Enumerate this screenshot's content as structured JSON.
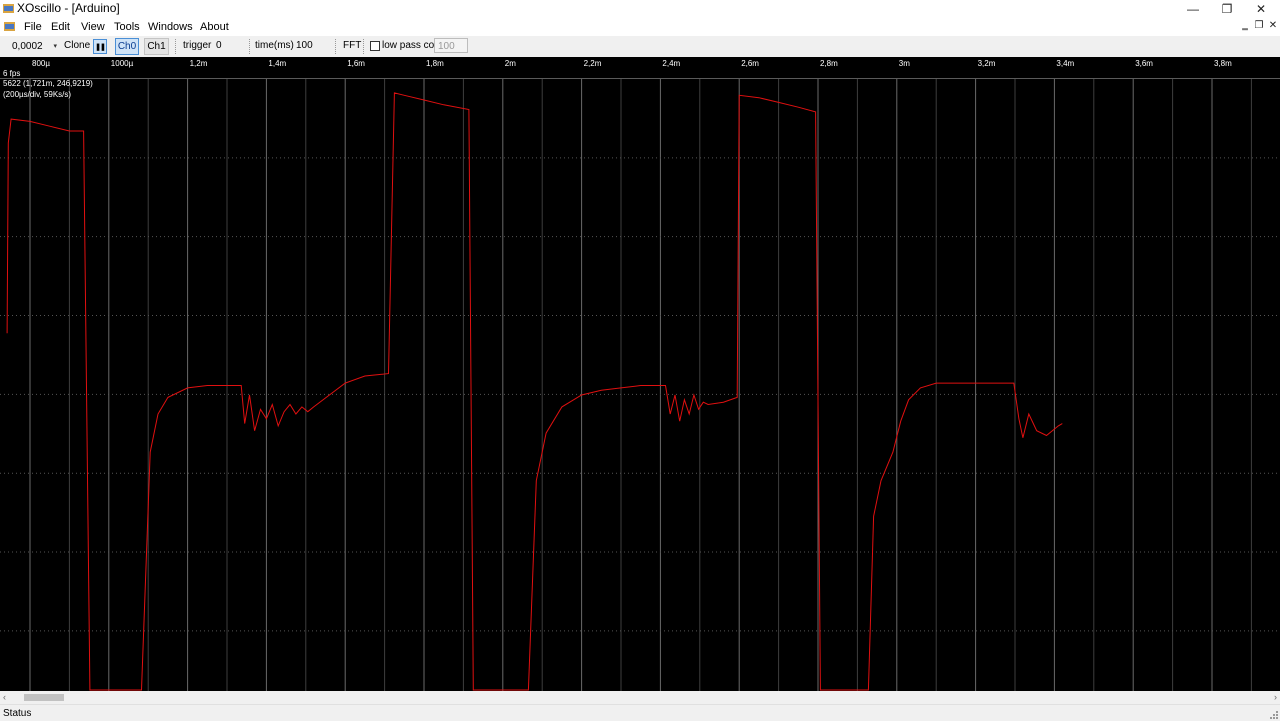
{
  "window": {
    "title": "XOscillo - [Arduino]",
    "minimize_glyph": "—",
    "maximize_glyph": "❐",
    "close_glyph": "✕"
  },
  "menu": {
    "items": [
      "File",
      "Edit",
      "View",
      "Tools",
      "Windows",
      "About"
    ],
    "mdi_minimize": "‗",
    "mdi_restore": "❐",
    "mdi_close": "✕"
  },
  "toolbar": {
    "scale_value": "0,0002",
    "combo_arrow": "▾",
    "clone_label": "Clone",
    "pause_glyph": "❚❚",
    "ch0_label": "Ch0",
    "ch1_label": "Ch1",
    "trigger_label": "trigger",
    "trigger_value": "0",
    "time_label": "time(ms)",
    "time_value": "100",
    "fft_label": "FFT",
    "lowpass_label": "low pass cof",
    "lowpass_value": "100"
  },
  "scope": {
    "fps": "6 fps",
    "cursor": "5622 (1,721m, 246,9219)",
    "scale_info": "(200µs/div, 59Ks/s)",
    "x_ticks": [
      "800µ",
      "1000µ",
      "1,2m",
      "1,4m",
      "1,6m",
      "1,8m",
      "2m",
      "2,2m",
      "2,4m",
      "2,6m",
      "2,8m",
      "3m",
      "3,2m",
      "3,4m",
      "3,6m",
      "3,8m"
    ],
    "trace_color": "#e01010",
    "grid_color": "#5a5a5a",
    "signal": {
      "time_axis": [
        0.74,
        3.96
      ],
      "value_axis": [
        0,
        256
      ],
      "points": [
        [
          0.742,
          150
        ],
        [
          0.745,
          230
        ],
        [
          0.752,
          240
        ],
        [
          0.8,
          239
        ],
        [
          0.85,
          237
        ],
        [
          0.9,
          235
        ],
        [
          0.936,
          235
        ],
        [
          0.952,
          0
        ],
        [
          1.01,
          0
        ],
        [
          1.083,
          0
        ],
        [
          1.105,
          100
        ],
        [
          1.125,
          116
        ],
        [
          1.15,
          123
        ],
        [
          1.2,
          127
        ],
        [
          1.25,
          128
        ],
        [
          1.3,
          128
        ],
        [
          1.336,
          128
        ],
        [
          1.345,
          112
        ],
        [
          1.357,
          124
        ],
        [
          1.37,
          109
        ],
        [
          1.385,
          118
        ],
        [
          1.4,
          114
        ],
        [
          1.415,
          120
        ],
        [
          1.43,
          111
        ],
        [
          1.445,
          117
        ],
        [
          1.46,
          120
        ],
        [
          1.475,
          116
        ],
        [
          1.49,
          119
        ],
        [
          1.505,
          117
        ],
        [
          1.52,
          119
        ],
        [
          1.56,
          124
        ],
        [
          1.6,
          129
        ],
        [
          1.65,
          132
        ],
        [
          1.71,
          133
        ],
        [
          1.725,
          251
        ],
        [
          1.75,
          250
        ],
        [
          1.8,
          248
        ],
        [
          1.85,
          246
        ],
        [
          1.914,
          244
        ],
        [
          1.925,
          0
        ],
        [
          1.97,
          0
        ],
        [
          2.065,
          0
        ],
        [
          2.085,
          88
        ],
        [
          2.11,
          108
        ],
        [
          2.15,
          119
        ],
        [
          2.2,
          124
        ],
        [
          2.25,
          126
        ],
        [
          2.3,
          127
        ],
        [
          2.35,
          128
        ],
        [
          2.413,
          128
        ],
        [
          2.425,
          116
        ],
        [
          2.437,
          124
        ],
        [
          2.449,
          113
        ],
        [
          2.461,
          122
        ],
        [
          2.473,
          116
        ],
        [
          2.485,
          124
        ],
        [
          2.497,
          118
        ],
        [
          2.509,
          121
        ],
        [
          2.521,
          120
        ],
        [
          2.56,
          121
        ],
        [
          2.595,
          123
        ],
        [
          2.6,
          250
        ],
        [
          2.65,
          249
        ],
        [
          2.7,
          247
        ],
        [
          2.75,
          245
        ],
        [
          2.794,
          243
        ],
        [
          2.806,
          0
        ],
        [
          2.85,
          0
        ],
        [
          2.9,
          0
        ],
        [
          2.928,
          0
        ],
        [
          2.941,
          73
        ],
        [
          2.96,
          88
        ],
        [
          2.99,
          100
        ],
        [
          3.01,
          113
        ],
        [
          3.03,
          122
        ],
        [
          3.06,
          127
        ],
        [
          3.1,
          129
        ],
        [
          3.15,
          129
        ],
        [
          3.2,
          129
        ],
        [
          3.25,
          129
        ],
        [
          3.297,
          129
        ],
        [
          3.31,
          114
        ],
        [
          3.32,
          106
        ],
        [
          3.335,
          116
        ],
        [
          3.355,
          109
        ],
        [
          3.38,
          107
        ],
        [
          3.41,
          111
        ],
        [
          3.42,
          112
        ]
      ]
    }
  },
  "scrollbar": {
    "left_arrow": "‹",
    "right_arrow": "›"
  },
  "status": {
    "text": "Status"
  }
}
